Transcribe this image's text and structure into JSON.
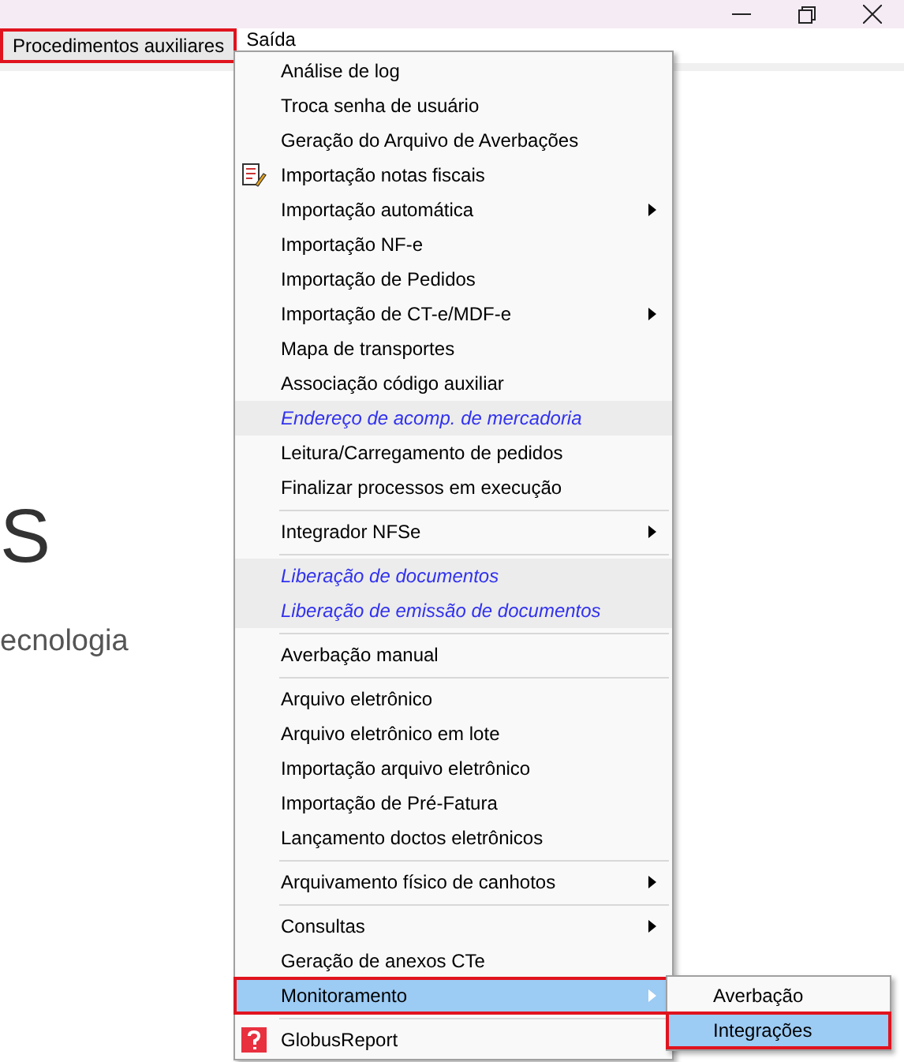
{
  "menu_bar": [
    {
      "label": "Procedimentos auxiliares",
      "selected": true
    },
    {
      "label": "Saída",
      "selected": false
    }
  ],
  "background": {
    "heading": "S",
    "subtitle": "ecnologia"
  },
  "menu": [
    {
      "kind": "item",
      "label": "Análise de log",
      "submenu": false,
      "selected": false
    },
    {
      "kind": "item",
      "label": "Troca senha de usuário",
      "submenu": false,
      "selected": false
    },
    {
      "kind": "item",
      "label": "Geração do Arquivo de Averbações",
      "submenu": false,
      "selected": false
    },
    {
      "kind": "document",
      "label": "Importação notas fiscais",
      "submenu": false,
      "selected": false
    },
    {
      "kind": "item",
      "label": "Importação automática",
      "submenu": true,
      "selected": false
    },
    {
      "kind": "item",
      "label": "Importação NF-e",
      "submenu": false,
      "selected": false
    },
    {
      "kind": "item",
      "label": "Importação de Pedidos",
      "submenu": false,
      "selected": false
    },
    {
      "kind": "item",
      "label": "Importação de CT-e/MDF-e",
      "submenu": true,
      "selected": false
    },
    {
      "kind": "item",
      "label": "Mapa de transportes",
      "submenu": false,
      "selected": false
    },
    {
      "kind": "item",
      "label": "Associação código auxiliar",
      "submenu": false,
      "selected": false
    },
    {
      "kind": "link",
      "label": "Endereço de acomp. de mercadoria",
      "submenu": false,
      "selected": false
    },
    {
      "kind": "item",
      "label": "Leitura/Carregamento de pedidos",
      "submenu": false,
      "selected": false
    },
    {
      "kind": "item",
      "label": "Finalizar processos em execução",
      "submenu": false,
      "selected": false
    },
    {
      "kind": "separator"
    },
    {
      "kind": "item",
      "label": "Integrador NFSe",
      "submenu": true,
      "selected": false
    },
    {
      "kind": "separator"
    },
    {
      "kind": "link",
      "label": "Liberação de documentos",
      "submenu": false,
      "selected": false
    },
    {
      "kind": "link",
      "label": "Liberação de emissão de documentos",
      "submenu": false,
      "selected": false
    },
    {
      "kind": "separator"
    },
    {
      "kind": "item",
      "label": "Averbação manual",
      "submenu": false,
      "selected": false
    },
    {
      "kind": "separator"
    },
    {
      "kind": "item",
      "label": "Arquivo eletrônico",
      "submenu": false,
      "selected": false
    },
    {
      "kind": "item",
      "label": "Arquivo eletrônico em lote",
      "submenu": false,
      "selected": false
    },
    {
      "kind": "item",
      "label": "Importação arquivo eletrônico",
      "submenu": false,
      "selected": false
    },
    {
      "kind": "item",
      "label": "Importação de Pré-Fatura",
      "submenu": false,
      "selected": false
    },
    {
      "kind": "item",
      "label": "Lançamento doctos eletrônicos",
      "submenu": false,
      "selected": false
    },
    {
      "kind": "separator"
    },
    {
      "kind": "item",
      "label": "Arquivamento físico de canhotos",
      "submenu": true,
      "selected": false
    },
    {
      "kind": "separator"
    },
    {
      "kind": "item",
      "label": "Consultas",
      "submenu": true,
      "selected": false
    },
    {
      "kind": "item",
      "label": "Geração de anexos CTe",
      "submenu": false,
      "selected": false
    },
    {
      "kind": "item",
      "label": "Monitoramento",
      "submenu": true,
      "selected": true
    },
    {
      "kind": "separator"
    },
    {
      "kind": "report",
      "label": "GlobusReport",
      "submenu": false,
      "selected": false
    }
  ],
  "submenu": [
    {
      "label": "Averbação",
      "selected": false
    },
    {
      "label": "Integrações",
      "selected": true
    }
  ]
}
